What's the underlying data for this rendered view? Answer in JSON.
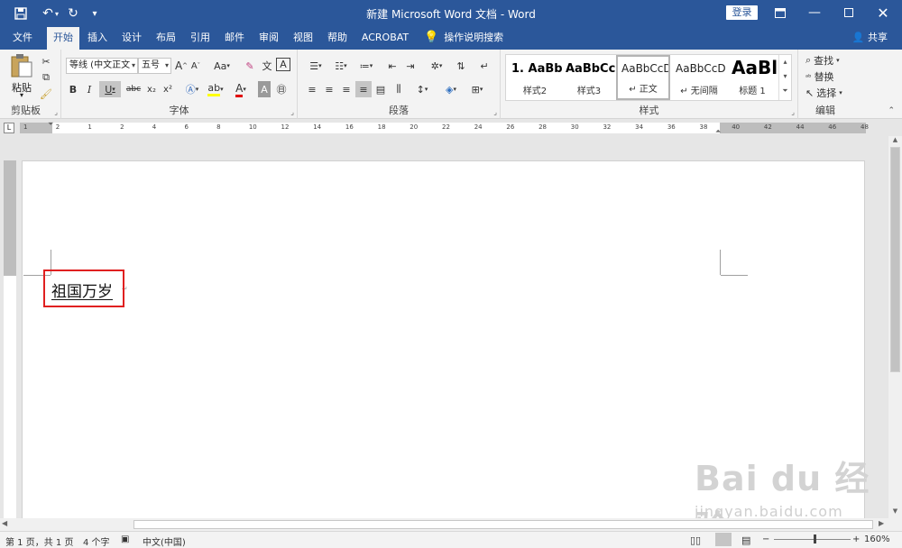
{
  "window": {
    "title": "新建 Microsoft Word 文档 - Word",
    "login_label": "登录",
    "qa_save": "save-icon",
    "qa_undo": "undo-icon",
    "qa_redo": "redo-icon"
  },
  "tabs": [
    {
      "label": "文件"
    },
    {
      "label": "开始"
    },
    {
      "label": "插入"
    },
    {
      "label": "设计"
    },
    {
      "label": "布局"
    },
    {
      "label": "引用"
    },
    {
      "label": "邮件"
    },
    {
      "label": "审阅"
    },
    {
      "label": "视图"
    },
    {
      "label": "帮助"
    },
    {
      "label": "ACROBAT"
    }
  ],
  "tell_me": "操作说明搜索",
  "share": "共享",
  "ribbon": {
    "clipboard": {
      "label": "剪贴板",
      "paste": "粘贴"
    },
    "font": {
      "label": "字体",
      "font_name": "等线 (中文正文",
      "font_size": "五号",
      "bold": "B",
      "italic": "I",
      "underline": "U",
      "strike": "abc",
      "sub": "x₂",
      "sup": "x²",
      "grow": "A",
      "shrink": "A",
      "case": "Aa"
    },
    "paragraph": {
      "label": "段落"
    },
    "styles": {
      "label": "样式",
      "items": [
        {
          "preview": "1. AaBb",
          "name": "样式2"
        },
        {
          "preview": "AaBbCcI",
          "name": "样式3"
        },
        {
          "preview": "AaBbCcDd",
          "name": "↵ 正文"
        },
        {
          "preview": "AaBbCcDd",
          "name": "↵ 无间隔"
        },
        {
          "preview": "AaBl",
          "name": "标题 1"
        }
      ]
    },
    "editing": {
      "label": "编辑",
      "find": "查找",
      "replace": "替换",
      "select": "选择"
    }
  },
  "ruler": {
    "numbers": [
      "1",
      "2",
      "1",
      "2",
      "4",
      "6",
      "8",
      "10",
      "12",
      "14",
      "16",
      "18",
      "20",
      "22",
      "24",
      "26",
      "28",
      "30",
      "32",
      "34",
      "36",
      "38",
      "40",
      "42",
      "44",
      "46",
      "48"
    ]
  },
  "document": {
    "text": "祖国万岁"
  },
  "statusbar": {
    "page": "第 1 页，共 1 页",
    "words": "4 个字",
    "language": "中文(中国)",
    "zoom": "160%"
  },
  "watermark": {
    "logo": "Bai du 经验",
    "url": "jingyan.baidu.com"
  }
}
